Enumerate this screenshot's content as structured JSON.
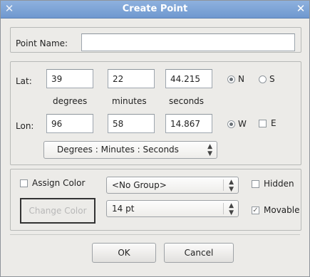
{
  "window": {
    "title": "Create Point",
    "menu_icon": "✕",
    "close_icon": "✕"
  },
  "point_name": {
    "label": "Point Name:",
    "value": ""
  },
  "lat": {
    "label": "Lat:",
    "degrees": "39",
    "minutes": "22",
    "seconds": "44.215",
    "hemisphere_options": [
      "N",
      "S"
    ],
    "selected": "N"
  },
  "units": {
    "degrees": "degrees",
    "minutes": "minutes",
    "seconds": "seconds"
  },
  "lon": {
    "label": "Lon:",
    "degrees": "96",
    "minutes": "58",
    "seconds": "14.867",
    "hemisphere_options": [
      "W",
      "E"
    ],
    "selected": "W"
  },
  "format_select": {
    "value": "Degrees : Minutes : Seconds"
  },
  "assign_color": {
    "label": "Assign Color",
    "checked": false
  },
  "group_select": {
    "value": "<No Group>"
  },
  "hidden": {
    "label": "Hidden",
    "checked": false
  },
  "change_color_button": {
    "label": "Change Color",
    "enabled": false
  },
  "size_select": {
    "value": "14 pt"
  },
  "movable": {
    "label": "Movable",
    "checked": true,
    "enabled": false
  },
  "buttons": {
    "ok": "OK",
    "cancel": "Cancel"
  }
}
